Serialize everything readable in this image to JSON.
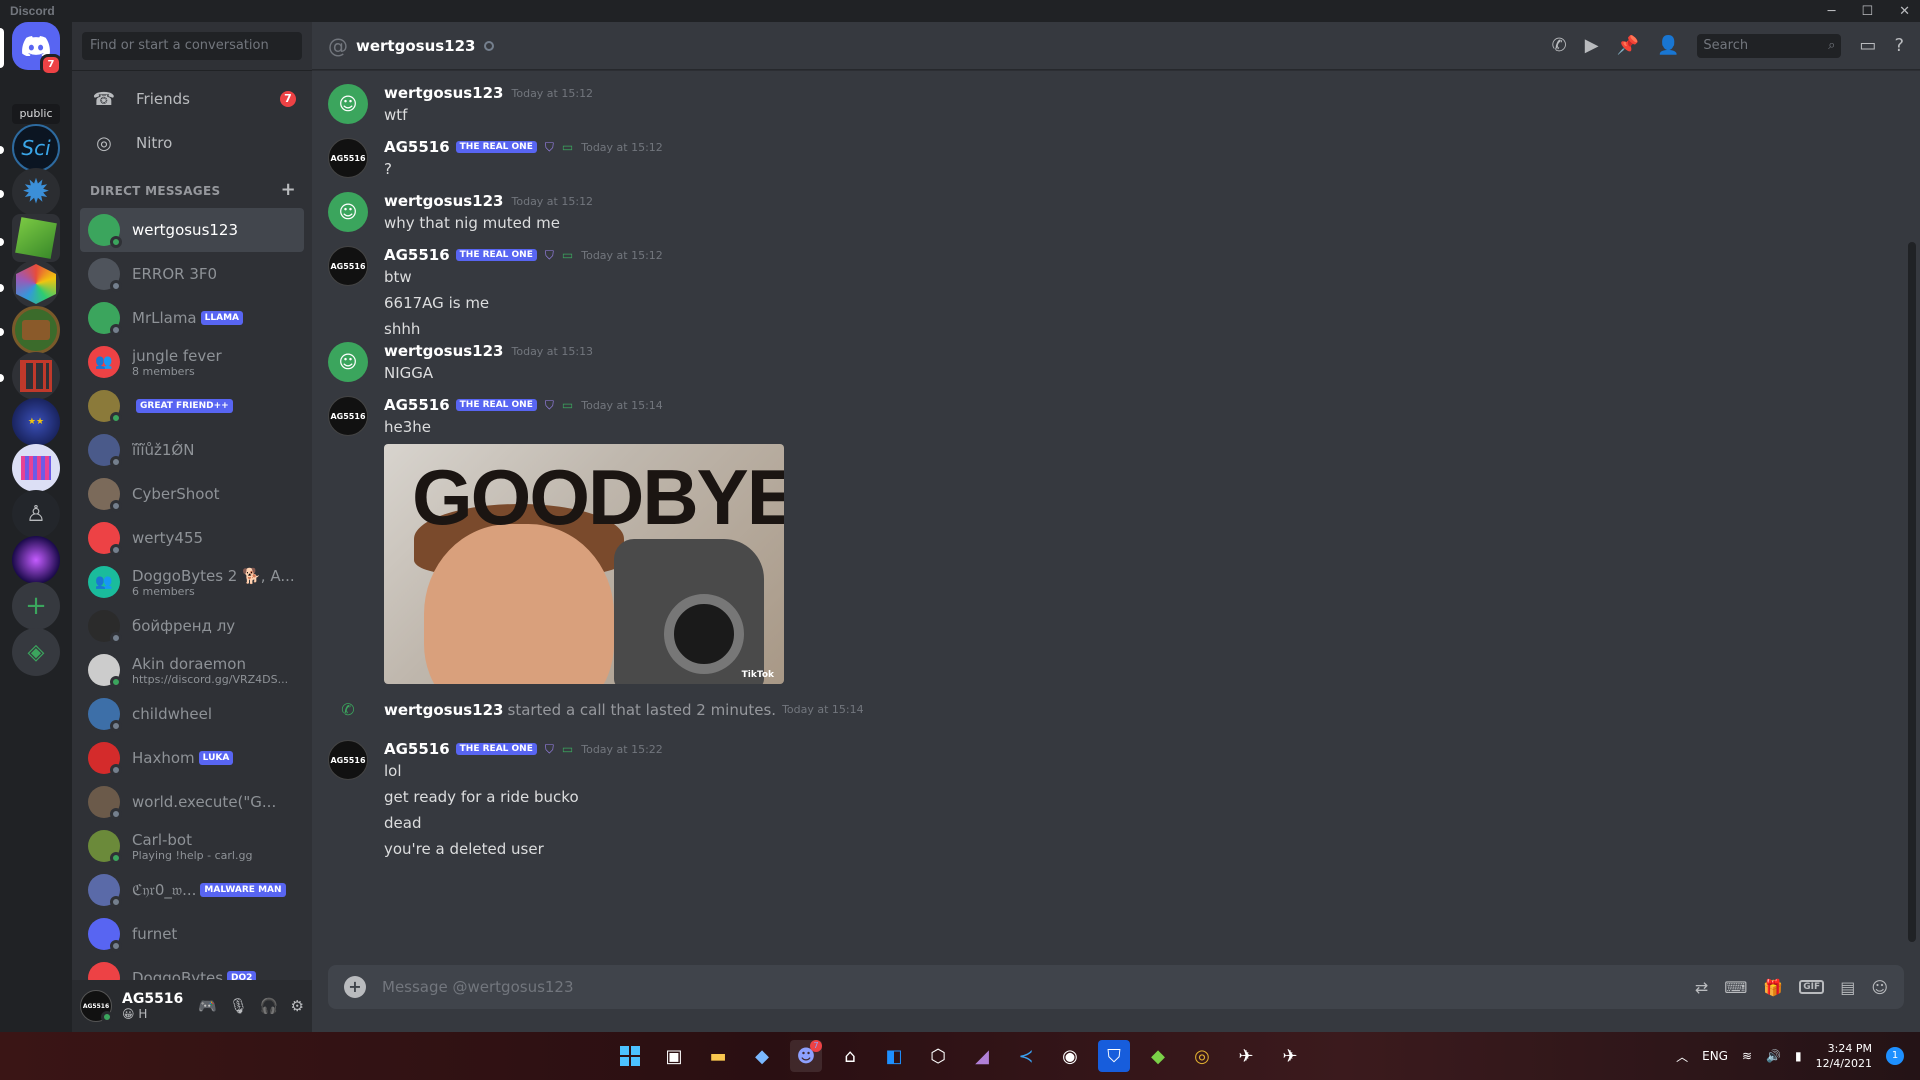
{
  "app": {
    "title": "Discord"
  },
  "guild_rail": {
    "home_badge": "7",
    "tooltip": "public",
    "servers": [
      {
        "icon": "sci-server-icon",
        "label": "Sci"
      },
      {
        "icon": "star-server-icon",
        "label": ""
      },
      {
        "icon": "cube-server-icon",
        "label": ""
      },
      {
        "icon": "hex-server-icon",
        "label": ""
      },
      {
        "icon": "book-server-icon",
        "label": ""
      },
      {
        "icon": "box-server-icon",
        "label": ""
      },
      {
        "icon": "galaxy-server-icon",
        "label": ""
      },
      {
        "icon": "tech-server-icon",
        "label": ""
      },
      {
        "icon": "dark-server-icon",
        "label": ""
      },
      {
        "icon": "nebula-server-icon",
        "label": ""
      }
    ]
  },
  "dm_panel": {
    "search_placeholder": "Find or start a conversation",
    "friends_label": "Friends",
    "friends_badge": "7",
    "nitro_label": "Nitro",
    "header": "DIRECT MESSAGES",
    "items": [
      {
        "name": "wertgosus123",
        "sub": "",
        "tag": "",
        "color": "#3ba55d",
        "status": "on",
        "active": true
      },
      {
        "name": "ERROR 3F0",
        "sub": "",
        "tag": "",
        "color": "#4f545c",
        "status": "off"
      },
      {
        "name": "MrLlama",
        "sub": "",
        "tag": "LLAMA",
        "color": "#3ba55d",
        "status": "off"
      },
      {
        "name": "jungle fever",
        "sub": "8 members",
        "tag": "",
        "color": "#ed4245",
        "status": "none"
      },
      {
        "name": "",
        "sub": "",
        "tag": "GREAT FRIEND++",
        "color": "#8b7a3a",
        "status": "on"
      },
      {
        "name": "ĩĩĩůž1ǾN",
        "sub": "",
        "tag": "",
        "color": "#4a5a8a",
        "status": "off"
      },
      {
        "name": "CyberShoot",
        "sub": "",
        "tag": "",
        "color": "#7b6a5a",
        "status": "off"
      },
      {
        "name": "werty455",
        "sub": "",
        "tag": "",
        "color": "#ed4245",
        "status": "off"
      },
      {
        "name": "DoggoBytes 2 🐕, A...",
        "sub": "6 members",
        "tag": "",
        "color": "#1abc9c",
        "status": "none"
      },
      {
        "name": "бойфренд лу",
        "sub": "",
        "tag": "",
        "color": "#2b2b2b",
        "status": "off"
      },
      {
        "name": "Akin doraemon",
        "sub": "https://discord.gg/VRZ4DS...",
        "tag": "",
        "color": "#cccccc",
        "status": "on"
      },
      {
        "name": "childwheel",
        "sub": "",
        "tag": "",
        "color": "#3d6fa8",
        "status": "off"
      },
      {
        "name": "Haxhom",
        "sub": "",
        "tag": "LUKA",
        "color": "#d42b2b",
        "status": "off"
      },
      {
        "name": "world.execute(\"G...",
        "sub": "",
        "tag": "",
        "color": "#6b5a4a",
        "status": "off"
      },
      {
        "name": "Carl-bot",
        "sub": "Playing !help - carl.gg",
        "tag": "",
        "color": "#6b8a3a",
        "status": "on"
      },
      {
        "name": "ℭ𝔶𝔯0_𝔴...",
        "sub": "",
        "tag": "MALWARE MAN",
        "color": "#5a6aa8",
        "status": "off"
      },
      {
        "name": "furnet",
        "sub": "",
        "tag": "",
        "color": "#5865f2",
        "status": "off"
      },
      {
        "name": "DoggoBytes",
        "sub": "",
        "tag": "DO2",
        "color": "#ed4245",
        "status": "off"
      }
    ]
  },
  "user_panel": {
    "name": "AG5516",
    "status": "😀 H",
    "avatar_text": "AG5516"
  },
  "chat": {
    "channel_name": "wertgosus123",
    "search_placeholder": "Search",
    "composer_placeholder": "Message @wertgosus123",
    "bot_tag": "THE REAL ONE",
    "messages": [
      {
        "author": "wertgosus123",
        "time": "Today at 15:12",
        "lines": [
          "wtf"
        ]
      },
      {
        "author": "AG5516",
        "time": "Today at 15:12",
        "lines": [
          "?"
        ]
      },
      {
        "author": "wertgosus123",
        "time": "Today at 15:12",
        "lines": [
          "why that nig muted me"
        ]
      },
      {
        "author": "AG5516",
        "time": "Today at 15:12",
        "lines": [
          "btw",
          "6617AG is me",
          "shhh"
        ]
      },
      {
        "author": "wertgosus123",
        "time": "Today at 15:13",
        "lines": [
          "NIGGA"
        ]
      },
      {
        "author": "AG5516",
        "time": "Today at 15:14",
        "lines": [
          "he3he"
        ],
        "image_text": "GOODBYE",
        "image_watermark": "TikTok"
      },
      {
        "author": "AG5516",
        "time": "Today at 15:22",
        "lines": [
          "lol",
          "get ready for a ride bucko",
          "dead",
          "you're a deleted user"
        ]
      }
    ],
    "call": {
      "author": "wertgosus123",
      "text": "started a call that lasted 2 minutes.",
      "time": "Today at 15:14"
    }
  },
  "taskbar": {
    "lang": "ENG",
    "time": "3:24 PM",
    "date": "12/4/2021",
    "notif_count": "1",
    "discord_badge": "7"
  }
}
